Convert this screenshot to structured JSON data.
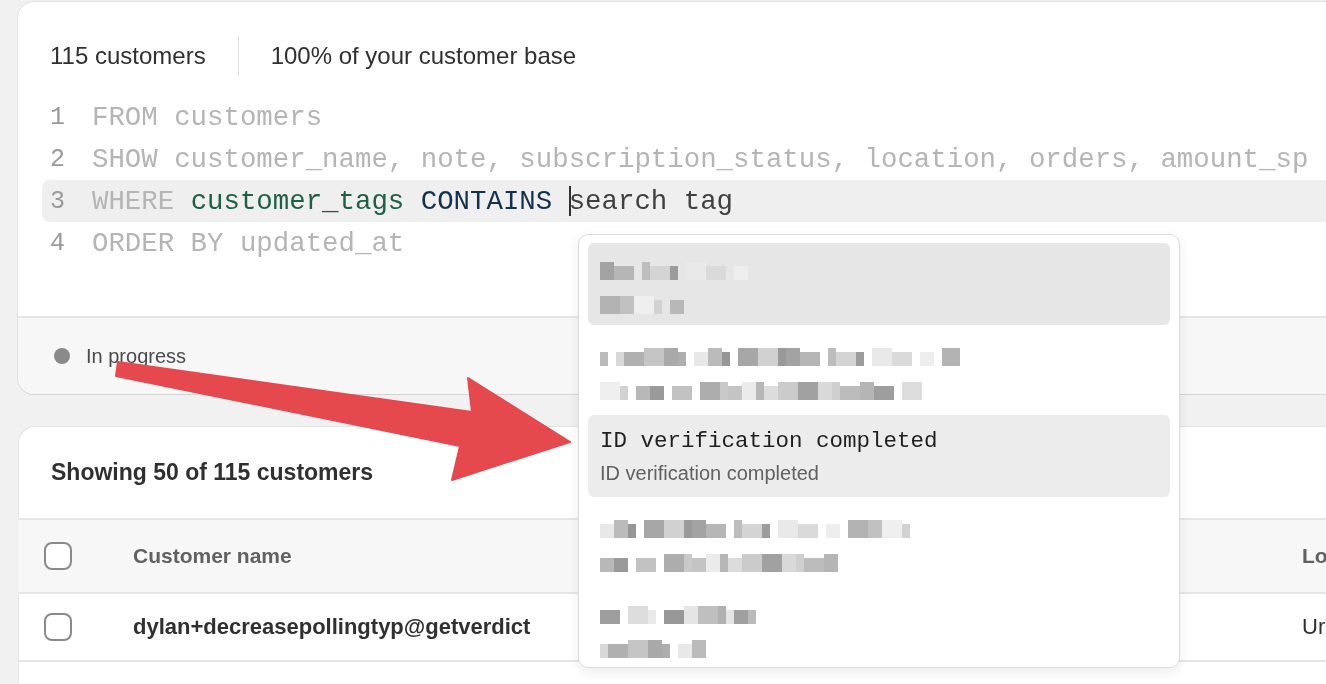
{
  "summary": {
    "count": "115 customers",
    "share": "100% of your customer base"
  },
  "editor": {
    "lines": [
      {
        "number": "1",
        "selected": false,
        "tokens": [
          {
            "kind": "keyword",
            "text": "FROM customers"
          }
        ]
      },
      {
        "number": "2",
        "selected": false,
        "tokens": [
          {
            "kind": "keyword",
            "text": "SHOW customer_name, note, subscription_status, location, orders, amount_sp"
          }
        ]
      },
      {
        "number": "3",
        "selected": true,
        "tokens": [
          {
            "kind": "keyword",
            "text": "WHERE"
          },
          {
            "kind": "field",
            "text": "customer_tags"
          },
          {
            "kind": "operator",
            "text": "CONTAINS"
          },
          {
            "kind": "input",
            "text": "search tag"
          }
        ]
      },
      {
        "number": "4",
        "selected": false,
        "tokens": [
          {
            "kind": "keyword",
            "text": "ORDER BY updated_at"
          }
        ]
      }
    ]
  },
  "status": {
    "label": "In progress"
  },
  "dropdown": {
    "items": [
      {
        "kind": "redacted",
        "selected": true
      },
      {
        "kind": "redacted",
        "selected": false
      },
      {
        "kind": "tag",
        "selected": false,
        "hovered": true,
        "title": "ID verification completed",
        "subtitle": "ID verification completed"
      },
      {
        "kind": "redacted",
        "selected": false
      },
      {
        "kind": "redacted",
        "selected": false
      }
    ]
  },
  "results": {
    "heading": "Showing 50 of 115 customers",
    "select_all": {
      "checked": false
    },
    "columns": [
      "Customer name",
      "Lo"
    ],
    "rows": [
      {
        "checked": false,
        "cells": [
          "dylan+decreasepollingtyp@getverdict",
          "Ur"
        ]
      }
    ]
  }
}
